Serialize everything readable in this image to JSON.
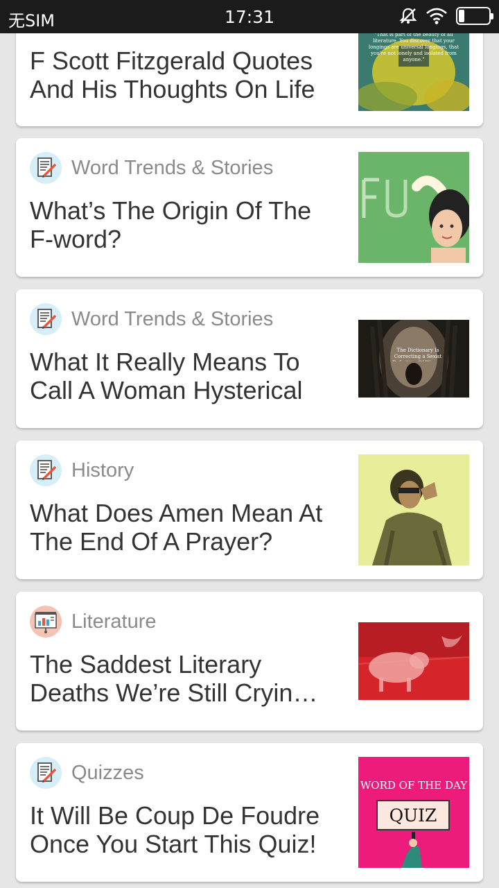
{
  "status_bar": {
    "carrier": "无SIM",
    "time": "17:31",
    "icons": [
      "mute-icon",
      "wifi-icon",
      "battery-icon"
    ]
  },
  "feed": {
    "cards": [
      {
        "category": "",
        "icon": "",
        "title_lines": [
          "F Scott Fitzgerald Quotes",
          "And His Thoughts On Life"
        ],
        "thumb_text": "\"That is part of the beauty of all literature. You discover that your longings are universal longings, that you're not lonely and isolated from anyone.\""
      },
      {
        "category": "Word Trends & Stories",
        "icon": "document-pencil-icon",
        "title_lines": [
          "What’s The Origin Of The",
          "F-word?"
        ]
      },
      {
        "category": "Word Trends & Stories",
        "icon": "document-pencil-icon",
        "title_lines": [
          "What It Really Means To",
          "Call A Woman Hysterical"
        ],
        "thumb_text": "The Dictionary Is Correcting a Sexist Definition Of Women"
      },
      {
        "category": "History",
        "icon": "document-pencil-icon",
        "title_lines": [
          "What Does Amen Mean At",
          "The End Of A Prayer?"
        ]
      },
      {
        "category": "Literature",
        "icon": "presentation-board-icon",
        "title_lines": [
          "The Saddest Literary",
          "Deaths We’re Still Cryin…"
        ]
      },
      {
        "category": "Quizzes",
        "icon": "document-pencil-icon",
        "title_lines": [
          "It Will Be Coup De Foudre",
          "Once You Start This Quiz!"
        ],
        "thumb_header": "WORD OF THE DAY",
        "thumb_sign": "QUIZ"
      }
    ]
  },
  "colors": {
    "status_bar_bg": "#1b1b1b",
    "page_bg": "#e6e6e6",
    "category_text": "#8a8a8a",
    "title_text": "#333333",
    "quiz_pink": "#ec1b7c"
  }
}
